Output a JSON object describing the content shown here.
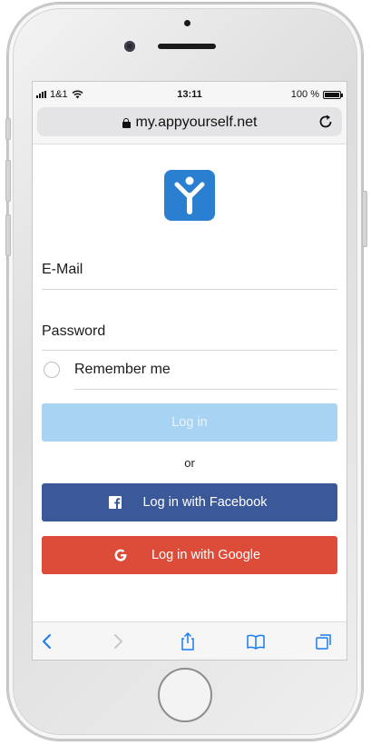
{
  "status_bar": {
    "carrier": "1&1",
    "time": "13:11",
    "battery": "100 %",
    "battery_level": 1.0
  },
  "browser": {
    "url": "my.appyourself.net"
  },
  "login_form": {
    "email_label": "E-Mail",
    "password_label": "Password",
    "remember_label": "Remember me",
    "remember_checked": false,
    "login_button": "Log in",
    "or_text": "or",
    "facebook_button": "Log in with Facebook",
    "google_button": "Log in with Google"
  },
  "colors": {
    "logo": "#2a7fd1",
    "login_disabled": "#a9d3f2",
    "facebook": "#3b5998",
    "google": "#dd4b39",
    "toolbar_active": "#1a7cf0",
    "toolbar_disabled": "#c7c7cc"
  },
  "toolbar": {
    "icons": [
      "back-icon",
      "forward-icon",
      "share-icon",
      "bookmarks-icon",
      "tabs-icon"
    ]
  }
}
